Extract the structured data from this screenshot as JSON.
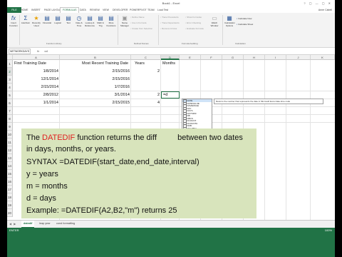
{
  "window": {
    "title": "Book1 - Excel",
    "controls": "? ▢ — ▢ ✕"
  },
  "ribbon_tabs": [
    "FILE",
    "HOME",
    "INSERT",
    "PAGE LAYOUT",
    "FORMULAS",
    "DATA",
    "REVIEW",
    "VIEW",
    "DEVELOPER",
    "POWERPIVOT",
    "TEAM",
    "Load Test"
  ],
  "active_tab": "FORMULAS",
  "user_name": "Anne Cabell",
  "ribbon": {
    "function_library": {
      "buttons": [
        {
          "label": "Insert Function",
          "icon": "fx-icon"
        },
        {
          "label": "AutoSum",
          "icon": "sigma-icon"
        },
        {
          "label": "Recently Used",
          "icon": "star-icon"
        },
        {
          "label": "Financial",
          "icon": "book-icon"
        },
        {
          "label": "Logical",
          "icon": "book-icon"
        },
        {
          "label": "Text",
          "icon": "book-icon"
        },
        {
          "label": "Date & Time",
          "icon": "clock-icon"
        },
        {
          "label": "Lookup & Reference",
          "icon": "book-icon"
        },
        {
          "label": "Math & Trig",
          "icon": "book-icon"
        },
        {
          "label": "More Functions",
          "icon": "book-icon"
        }
      ],
      "label": "Function Library"
    },
    "defined_names": {
      "name_manager": "Name Manager",
      "items": [
        "Define Name",
        "Use in Formula",
        "Create from Selection"
      ],
      "label": "Defined Names"
    },
    "formula_auditing": {
      "items": [
        "Trace Precedents",
        "Trace Dependents",
        "Remove Arrows",
        "Show Formulas",
        "Error Checking",
        "Evaluate Formula"
      ],
      "watch": "Watch Window",
      "label": "Formula Auditing"
    },
    "calculation": {
      "options": "Calculation Options",
      "items": [
        "Calculate Now",
        "Calculate Sheet"
      ],
      "label": "Calculation"
    }
  },
  "formula_bar": {
    "name_box": "NETWORKDAYS",
    "fx": "fx",
    "value": "=d"
  },
  "columns": [
    "A",
    "B",
    "C",
    "D",
    "E",
    "F",
    "G",
    "H",
    "I",
    "J",
    "K"
  ],
  "rows": [
    "1",
    "2",
    "3",
    "4",
    "5",
    "6",
    "7",
    "8",
    "9",
    "10",
    "11",
    "12",
    "13",
    "14",
    "15",
    "16",
    "17",
    "18",
    "19",
    "20"
  ],
  "headers": {
    "a": "First Training Date",
    "b": "Most Recent Training Date",
    "c": "Years",
    "d": "Months"
  },
  "data_rows": [
    {
      "a": "1/8/2014",
      "b": "2/15/2016",
      "c": "2",
      "d": "=d"
    },
    {
      "a": "12/1/2014",
      "b": "2/15/2016",
      "c": "",
      "d": ""
    },
    {
      "a": "2/15/2014",
      "b": "1/7/2016",
      "c": "",
      "d": ""
    },
    {
      "a": "2/8/2012",
      "b": "3/1/2014",
      "c": "2",
      "d": ""
    },
    {
      "a": "1/1/2014",
      "b": "2/15/2015",
      "c": "4",
      "d": ""
    }
  ],
  "autocomplete": {
    "items": [
      "DATE",
      "DATEVALUE",
      "DAVERAGE",
      "DAY",
      "DAYS",
      "DAYS360",
      "DB",
      "DBCS",
      "DCOUNT",
      "DCOUNTA",
      "DDB",
      "DEC2BIN",
      "DEC2HEX",
      "DEC2OCT",
      "DECIMAL",
      "DEGREES",
      "DELTA"
    ],
    "tooltip": "Returns the number that represents the date in Microsoft Excel date-time code"
  },
  "overlay": {
    "line1_prefix": "The ",
    "line1_func": "DATEDIF",
    "line1_suffix": " function returns the diff",
    "line1_tail": " between two dates",
    "line2": "in days, months, or years.",
    "line3": "SYNTAX =DATEDIF(start_date,end_date,interval)",
    "line4": "y = years",
    "line5": "m = months",
    "line6": "d = days",
    "line7": "Example: =DATEDIF(A2,B2,\"m\") returns 25"
  },
  "sheet_tabs": [
    "datedif",
    "leap year",
    "cond formatting"
  ],
  "active_sheet": "datedif",
  "status": {
    "mode": "ENTER",
    "zoom": "100%"
  }
}
